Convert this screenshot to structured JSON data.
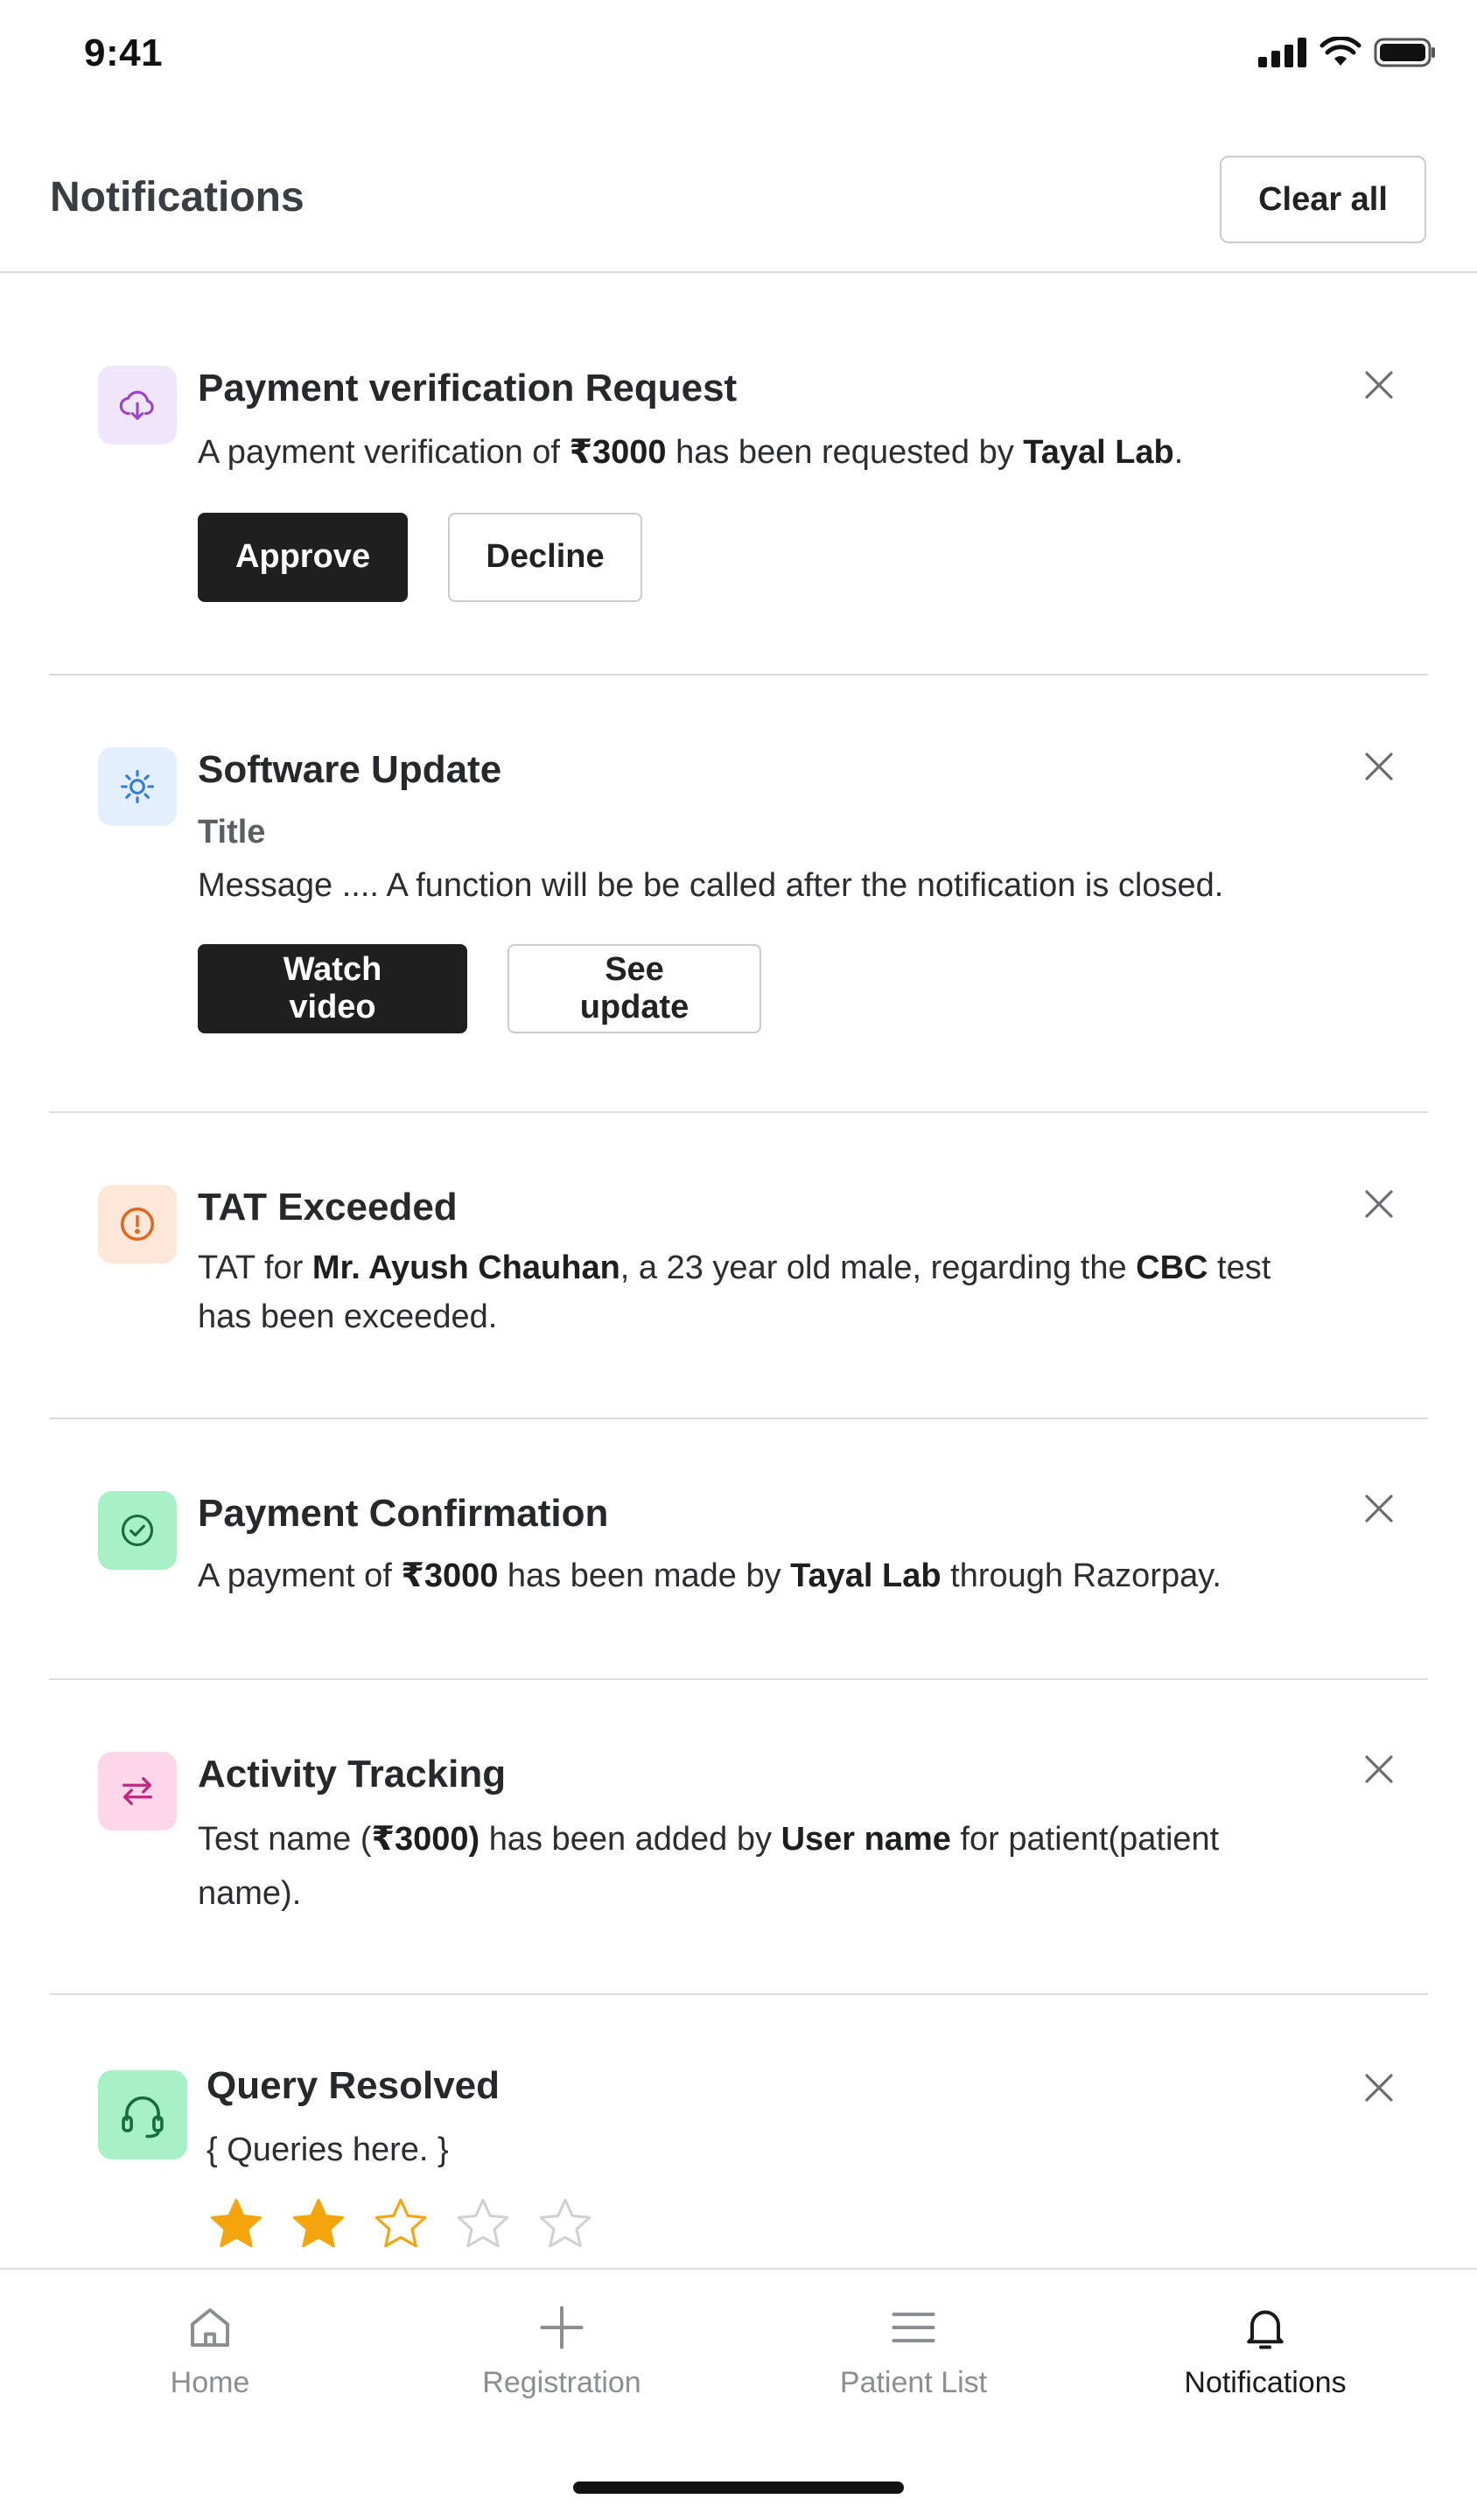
{
  "status": {
    "time": "9:41"
  },
  "header": {
    "title": "Notifications",
    "clear_all": "Clear all"
  },
  "notifications": [
    {
      "icon": "cloud-download-icon",
      "title": "Payment verification Request",
      "message": [
        {
          "t": "A payment verification of "
        },
        {
          "t": "₹3000",
          "b": true
        },
        {
          "t": " has been requested by "
        },
        {
          "t": "Tayal Lab",
          "b": true
        },
        {
          "t": "."
        }
      ],
      "buttons": {
        "primary": "Approve",
        "secondary": "Decline"
      }
    },
    {
      "icon": "sun-icon",
      "title": "Software Update",
      "subtitle": "Title",
      "message": [
        {
          "t": "Message .... A function will be be called after the notification is closed."
        }
      ],
      "buttons": {
        "primary": "Watch video",
        "secondary": "See update"
      }
    },
    {
      "icon": "alert-circle-icon",
      "title": "TAT Exceeded",
      "message": [
        {
          "t": "TAT for "
        },
        {
          "t": "Mr. Ayush Chauhan",
          "b": true
        },
        {
          "t": ", a 23 year old male, regarding the "
        },
        {
          "t": "CBC",
          "b": true
        },
        {
          "t": " test has been exceeded."
        }
      ]
    },
    {
      "icon": "check-circle-icon",
      "title": "Payment Confirmation",
      "message": [
        {
          "t": "A payment of "
        },
        {
          "t": "₹3000",
          "b": true
        },
        {
          "t": " has been made by "
        },
        {
          "t": "Tayal Lab",
          "b": true
        },
        {
          "t": " through Razorpay."
        }
      ]
    },
    {
      "icon": "arrows-swap-icon",
      "title": "Activity Tracking",
      "message": [
        {
          "t": "Test name ("
        },
        {
          "t": "₹3000)",
          "b": true
        },
        {
          "t": " has been added by "
        },
        {
          "t": "User name",
          "b": true
        },
        {
          "t": " for patient(patient name)."
        }
      ]
    },
    {
      "icon": "headset-icon",
      "title": "Query Resolved",
      "message": [
        {
          "t": "{ Queries here. }"
        }
      ],
      "rating": {
        "value": 2,
        "max": 5
      }
    }
  ],
  "colors": {
    "purple_bg": "#f0e6fb",
    "purple": "#9b40d1",
    "blue_bg": "#e3efff",
    "blue": "#2f7de1",
    "orange_bg": "#fde7d9",
    "orange": "#e2651b",
    "green_bg": "#a8f0c6",
    "green": "#1b6b3f",
    "pink_bg": "#fcd7ea",
    "pink": "#c4257d",
    "star": "#f5a40b"
  },
  "bottom_nav": [
    {
      "label": "Home",
      "icon": "home-icon",
      "active": false
    },
    {
      "label": "Registration",
      "icon": "plus-icon",
      "active": false
    },
    {
      "label": "Patient List",
      "icon": "list-icon",
      "active": false
    },
    {
      "label": "Notifications",
      "icon": "bell-icon",
      "active": true
    }
  ]
}
